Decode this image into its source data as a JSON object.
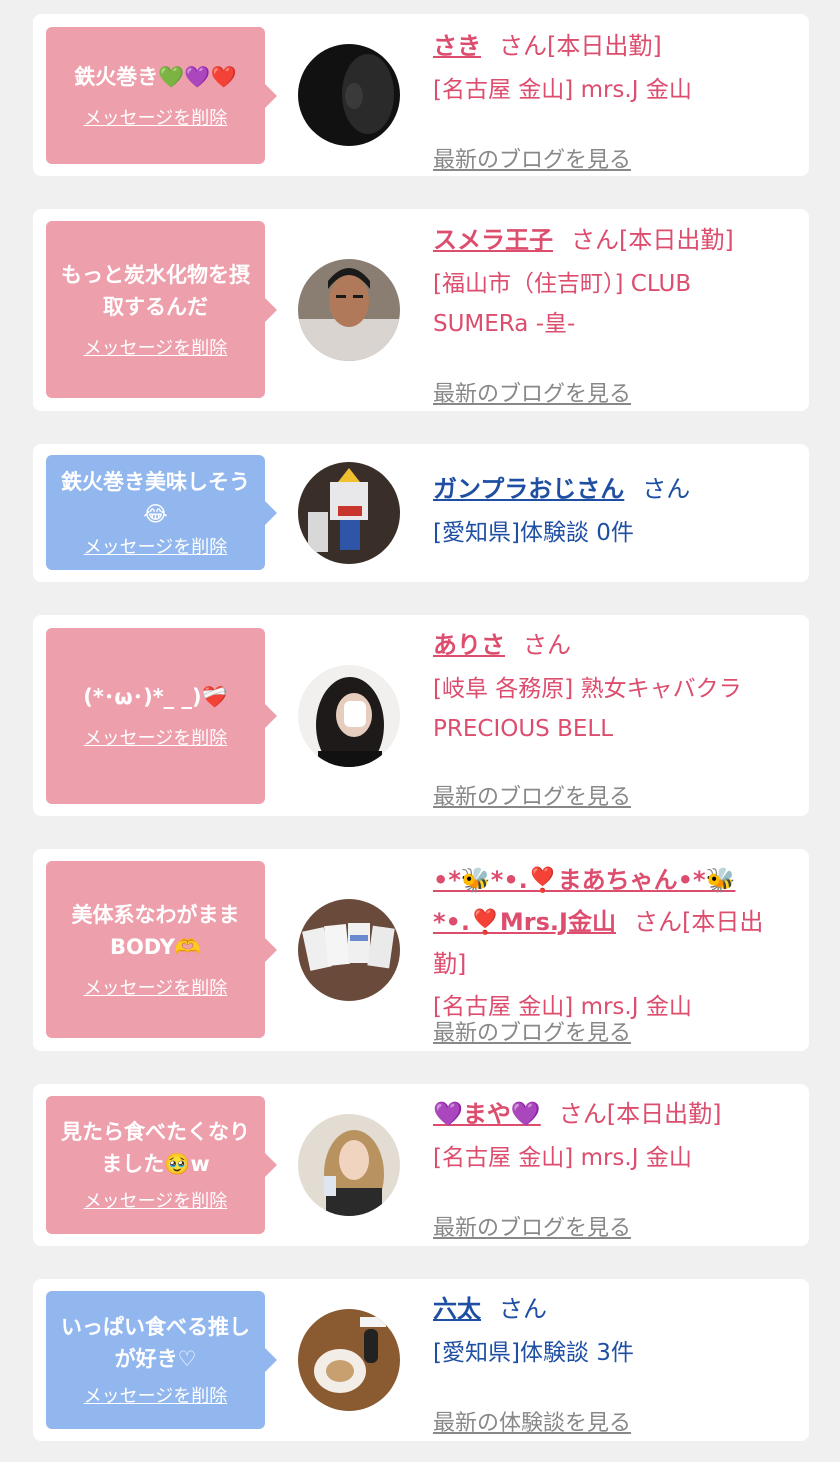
{
  "colors": {
    "background": "#f0f0f0",
    "card": "#ffffff",
    "bubble_pink": "#ee9fac",
    "bubble_blue": "#92b7ee",
    "name_pink": "#dc4d6e",
    "name_blue": "#1f4fa2",
    "link_gray": "#888888"
  },
  "entries": [
    {
      "message": "鉄火巻き💚💜❤️",
      "delete_label": "メッセージを削除",
      "name": "さき",
      "honorific": "さん[本日出勤]",
      "shop": "[名古屋 金山] mrs.J 金山",
      "link": "最新のブログを見る"
    },
    {
      "message": "もっと炭水化物を摂取するんだ",
      "delete_label": "メッセージを削除",
      "name": "スメラ王子",
      "honorific": "さん[本日出勤]",
      "shop": "[福山市（住吉町）] CLUB SUMERa -皇-",
      "link": "最新のブログを見る"
    },
    {
      "message": "鉄火巻き美味しそう😂",
      "delete_label": "メッセージを削除",
      "name": "ガンプラおじさん",
      "honorific": "さん",
      "shop": "[愛知県]体験談 0件",
      "link": ""
    },
    {
      "message": "(*･ω･)*_ _)❤️‍🩹",
      "delete_label": "メッセージを削除",
      "name": "ありさ",
      "honorific": "さん",
      "shop": "[岐阜 各務原] 熟女キャバクラ PRECIOUS BELL",
      "link": "最新のブログを見る"
    },
    {
      "message": "美体系なわがままBODY🫶",
      "delete_label": "メッセージを削除",
      "name": "•*🐝*•.❣️まあちゃん•*🐝*•.❣️Mrs.J金山",
      "honorific": "さん[本日出勤]",
      "shop": "[名古屋 金山] mrs.J 金山",
      "link": "最新のブログを見る"
    },
    {
      "message": "見たら食べたくなりました🥹w",
      "delete_label": "メッセージを削除",
      "name": "💜まや💜",
      "honorific": "さん[本日出勤]",
      "shop": "[名古屋 金山] mrs.J 金山",
      "link": "最新のブログを見る"
    },
    {
      "message": "いっぱい食べる推しが好き♡",
      "delete_label": "メッセージを削除",
      "name": "六太",
      "honorific": "さん",
      "shop": "[愛知県]体験談 3件",
      "link": "最新の体験談を見る"
    }
  ]
}
